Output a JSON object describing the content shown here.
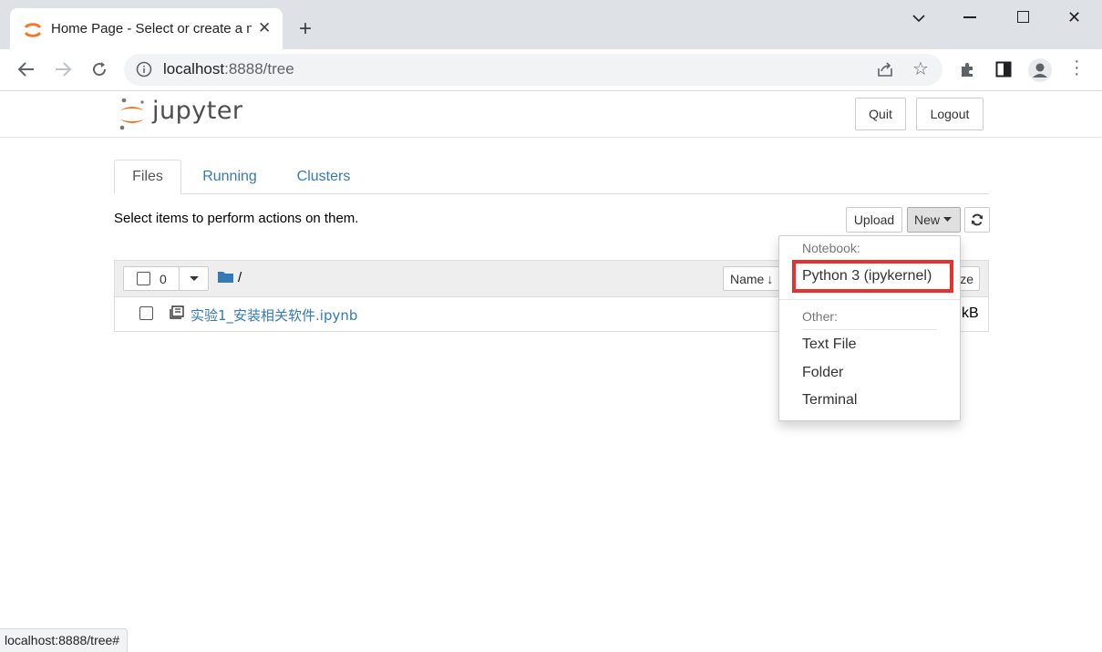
{
  "browser": {
    "tab_title": "Home Page - Select or create a notebook",
    "url_host": "localhost",
    "url_path": ":8888/tree",
    "status_url": "localhost:8888/tree#"
  },
  "jupyter": {
    "logo_text": "jupyter",
    "quit_label": "Quit",
    "logout_label": "Logout",
    "tabs": [
      {
        "label": "Files"
      },
      {
        "label": "Running"
      },
      {
        "label": "Clusters"
      }
    ],
    "hint": "Select items to perform actions on them.",
    "upload_label": "Upload",
    "new_label": "New",
    "selected_count": "0",
    "breadcrumb": "/",
    "sort_name_label": "Name",
    "size_partial": "ze",
    "files": [
      {
        "name": "实验1_安装相关软件.ipynb",
        "size_partial": "kB"
      }
    ],
    "new_menu": {
      "notebook_header": "Notebook:",
      "notebook_items": [
        "Python 3 (ipykernel)"
      ],
      "other_header": "Other:",
      "other_items": [
        "Text File",
        "Folder",
        "Terminal"
      ]
    }
  },
  "colors": {
    "accent_link": "#337ab7",
    "jupyter_orange": "#f37726",
    "highlight_red": "#e8312e"
  }
}
